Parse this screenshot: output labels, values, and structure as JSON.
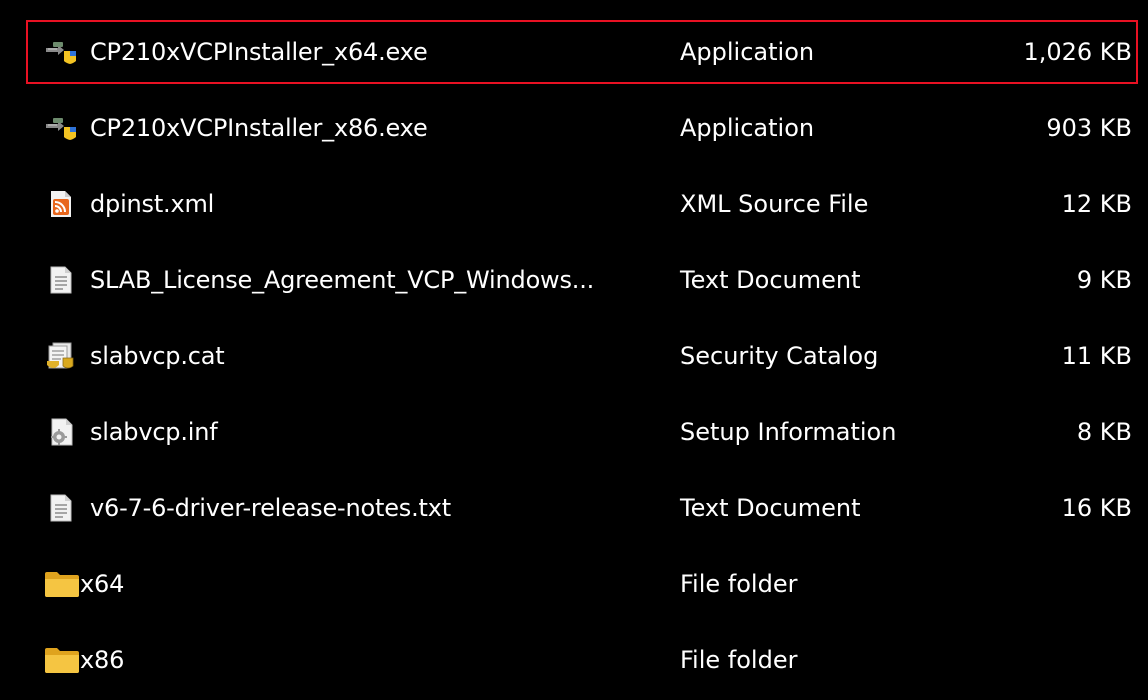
{
  "files": [
    {
      "name": "CP210xVCPInstaller_x64.exe",
      "type": "Application",
      "size": "1,026 KB",
      "icon": "installer-icon",
      "selected": true
    },
    {
      "name": "CP210xVCPInstaller_x86.exe",
      "type": "Application",
      "size": "903 KB",
      "icon": "installer-icon",
      "selected": false
    },
    {
      "name": "dpinst.xml",
      "type": "XML Source File",
      "size": "12 KB",
      "icon": "xml-feed-icon",
      "selected": false
    },
    {
      "name": "SLAB_License_Agreement_VCP_Windows...",
      "type": "Text Document",
      "size": "9 KB",
      "icon": "text-document-icon",
      "selected": false
    },
    {
      "name": "slabvcp.cat",
      "type": "Security Catalog",
      "size": "11 KB",
      "icon": "security-catalog-icon",
      "selected": false
    },
    {
      "name": "slabvcp.inf",
      "type": "Setup Information",
      "size": "8 KB",
      "icon": "setup-information-icon",
      "selected": false
    },
    {
      "name": "v6-7-6-driver-release-notes.txt",
      "type": "Text Document",
      "size": "16 KB",
      "icon": "text-document-icon",
      "selected": false
    },
    {
      "name": "x64",
      "type": "File folder",
      "size": "",
      "icon": "folder-icon",
      "selected": false
    },
    {
      "name": "x86",
      "type": "File folder",
      "size": "",
      "icon": "folder-icon",
      "selected": false
    }
  ],
  "colors": {
    "background": "#000000",
    "text": "#ffffff",
    "selection_border": "#e81123",
    "folder": "#f4c542"
  }
}
